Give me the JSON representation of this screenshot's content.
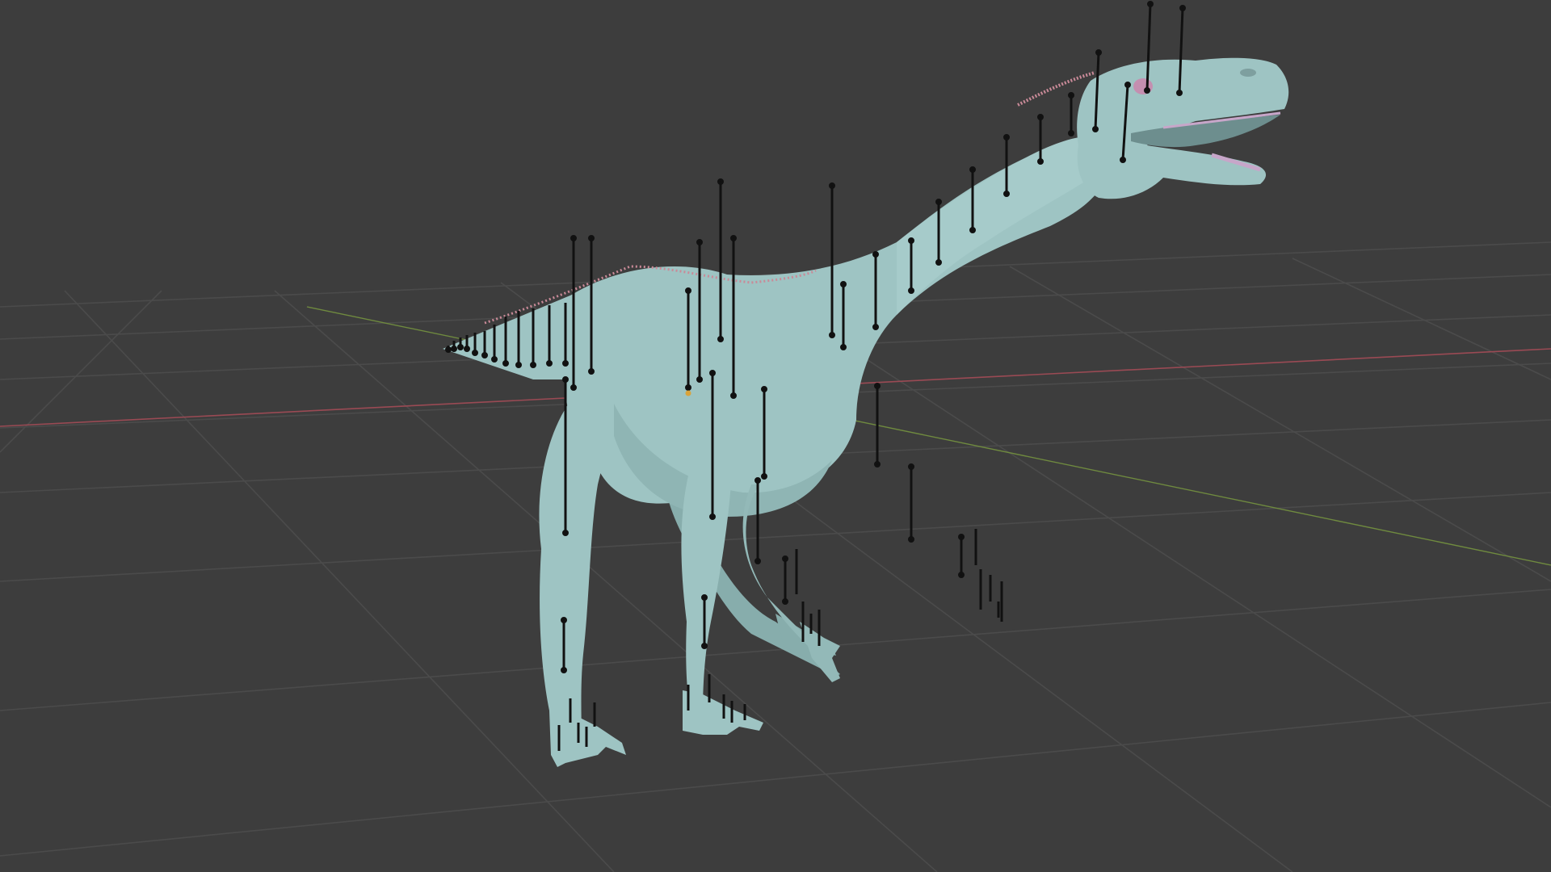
{
  "app": {
    "name": "3D viewport",
    "mode": "object-with-bones"
  },
  "viewport": {
    "background_color": "#3d3d3d",
    "grid_color": "#4a4a4a",
    "x_axis_color": "#9a4a54",
    "y_axis_color": "#6f8a3f"
  },
  "model": {
    "mesh_color": "#9ec4c3",
    "mesh_shadow_color": "#7fa3a3",
    "spine_spike_color": "#c98a98",
    "eye_color": "#c48fb0",
    "teeth_color": "#c7a6c9",
    "bone_color": "#111111",
    "origin_point_color": "#d9a33b",
    "icons": [
      "dinosaur-mesh",
      "armature-bones",
      "origin-point"
    ]
  }
}
